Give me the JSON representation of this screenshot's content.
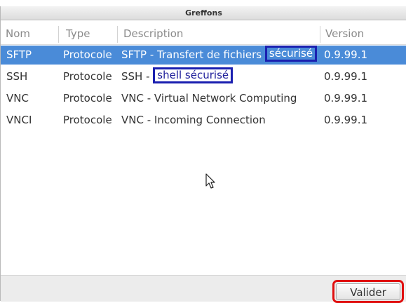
{
  "window": {
    "title": "Greffons"
  },
  "table": {
    "columns": [
      "Nom",
      "Type",
      "Description",
      "Version"
    ],
    "rows": [
      {
        "name": "SFTP",
        "type": "Protocole",
        "desc_plain": "SFTP - Transfert de fichiers ",
        "desc_highlight": "sécurisé",
        "version": "0.9.99.1"
      },
      {
        "name": "SSH",
        "type": "Protocole",
        "desc_plain": "SSH - ",
        "desc_highlight": "shell sécurisé",
        "version": "0.9.99.1"
      },
      {
        "name": "VNC",
        "type": "Protocole",
        "desc_plain": "VNC - Virtual Network Computing",
        "desc_highlight": "",
        "version": "0.9.99.1"
      },
      {
        "name": "VNCI",
        "type": "Protocole",
        "desc_plain": "VNC - Incoming Connection",
        "desc_highlight": "",
        "version": "0.9.99.1"
      }
    ],
    "selected_index": 0
  },
  "footer": {
    "ok_label": "Valider"
  },
  "colors": {
    "selection": "#4a8bd8",
    "highlight_border": "#1a1fb0",
    "button_ring": "#e01010"
  }
}
